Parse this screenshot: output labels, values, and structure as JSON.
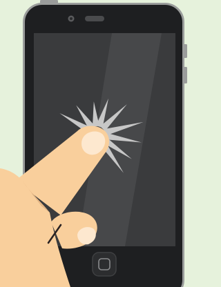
{
  "colors": {
    "background": "#e6f2dc",
    "phone_rim": "#9a9c9b",
    "phone_body": "#1e1f21",
    "screen": "#3a3b3d",
    "screen_highlight": "#47484a",
    "skin": "#f9cf9c",
    "skin_shadow": "#e8b784",
    "nail": "#fde8cf",
    "burst": "#c7c7c7"
  },
  "icons": {
    "front_camera": "camera-dot-icon",
    "speaker": "speaker-slot-icon",
    "home_button": "home-button-icon",
    "tap_burst": "tap-burst-icon"
  }
}
